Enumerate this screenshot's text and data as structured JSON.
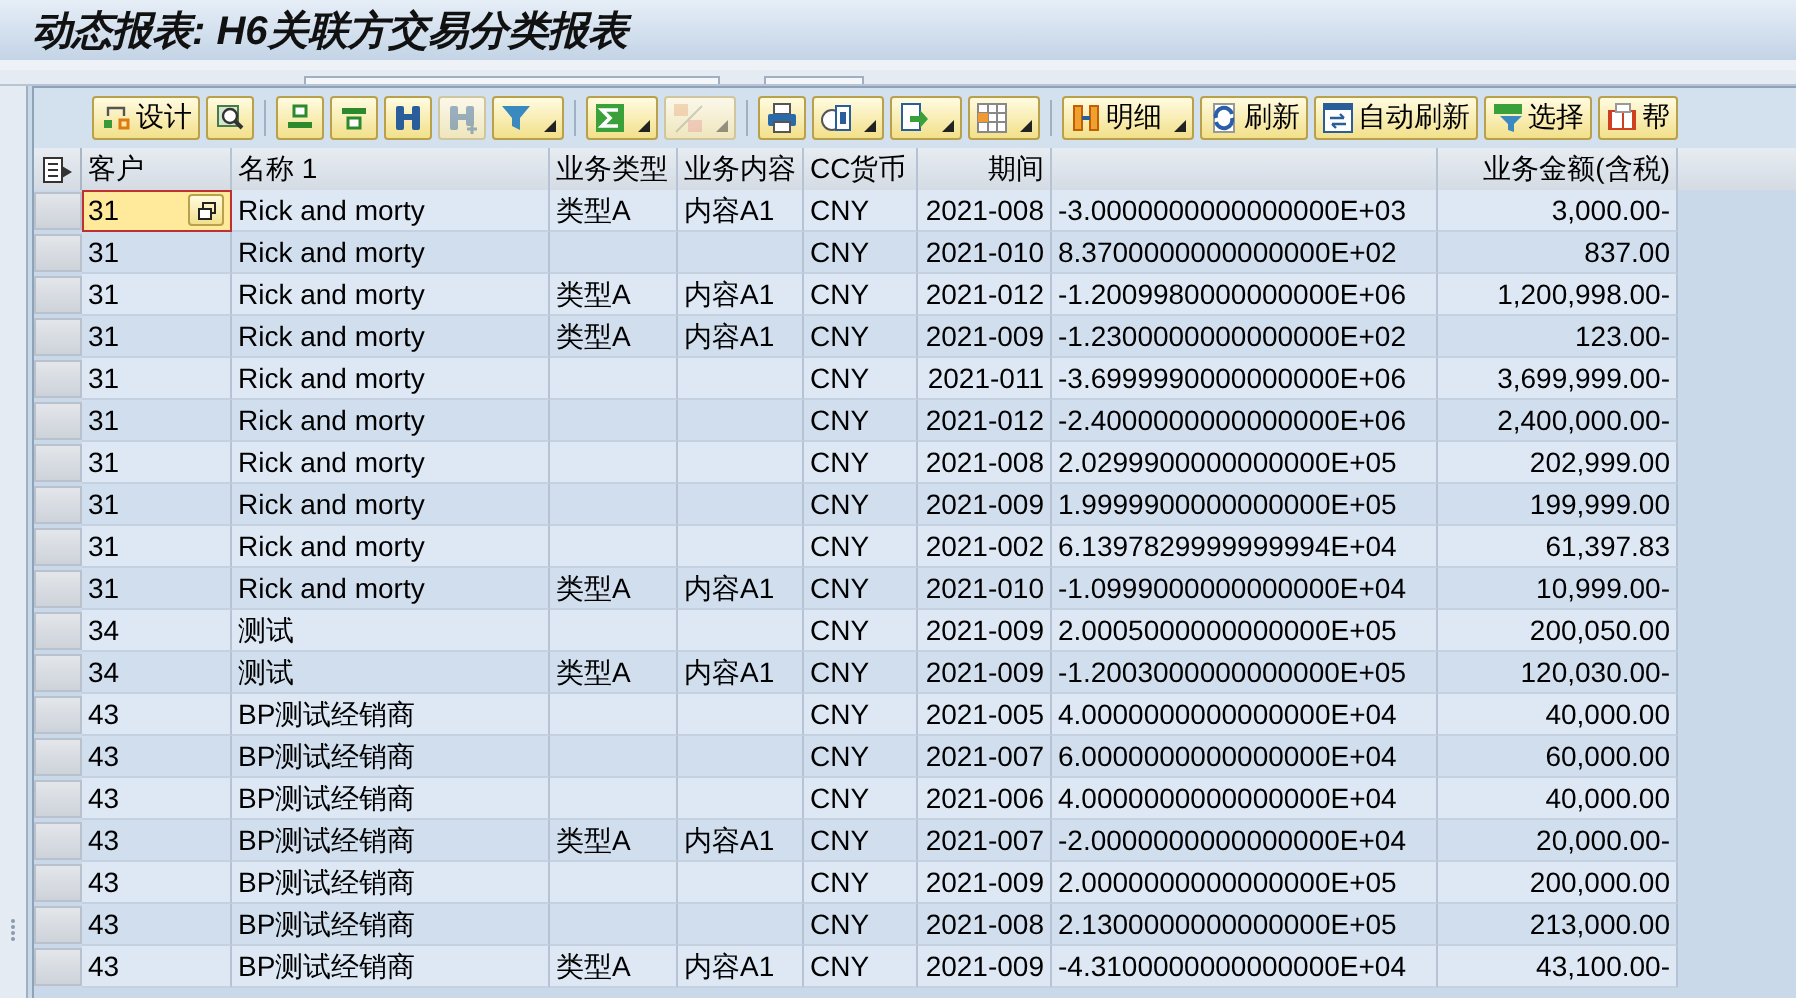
{
  "window": {
    "title": "动态报表: H6关联方交易分类报表"
  },
  "toolbar": [
    {
      "kind": "button",
      "label": "设计",
      "dropdown": false,
      "disabled": false
    },
    {
      "kind": "button",
      "dropdown": false,
      "disabled": false
    },
    {
      "kind": "separator"
    },
    {
      "kind": "button",
      "dropdown": false,
      "disabled": false
    },
    {
      "kind": "button",
      "dropdown": false,
      "disabled": false
    },
    {
      "kind": "button",
      "dropdown": false,
      "disabled": false
    },
    {
      "kind": "button",
      "dropdown": false,
      "disabled": true
    },
    {
      "kind": "button",
      "dropdown": true,
      "disabled": false
    },
    {
      "kind": "separator"
    },
    {
      "kind": "button",
      "dropdown": true,
      "disabled": false
    },
    {
      "kind": "button",
      "dropdown": true,
      "disabled": true
    },
    {
      "kind": "separator"
    },
    {
      "kind": "button",
      "dropdown": false,
      "disabled": false
    },
    {
      "kind": "button",
      "dropdown": true,
      "disabled": false
    },
    {
      "kind": "button",
      "dropdown": true,
      "disabled": false
    },
    {
      "kind": "button",
      "dropdown": true,
      "disabled": false
    },
    {
      "kind": "separator"
    },
    {
      "kind": "button",
      "label": "明细",
      "dropdown": true,
      "disabled": false
    },
    {
      "kind": "button",
      "label": "刷新",
      "dropdown": false,
      "disabled": false
    },
    {
      "kind": "button",
      "label": "自动刷新",
      "dropdown": false,
      "disabled": false
    },
    {
      "kind": "button",
      "label": "选择",
      "dropdown": false,
      "disabled": false
    },
    {
      "kind": "button",
      "label": "帮",
      "dropdown": false,
      "disabled": false
    }
  ],
  "table": {
    "columns": [
      {
        "label": "客户"
      },
      {
        "label": "名称 1"
      },
      {
        "label": "业务类型"
      },
      {
        "label": "业务内容"
      },
      {
        "label": "CC货币"
      },
      {
        "label": "期间"
      },
      {},
      {
        "label": "业务金额(含税)"
      }
    ],
    "rows": [
      {
        "focused": true,
        "customer": "31",
        "name": "Rick and morty",
        "type": "类型A",
        "content": "内容A1",
        "currency": "CNY",
        "period": "2021-008",
        "column_8": "-3.0000000000000000E+03",
        "amount": "3,000.00-"
      },
      {
        "focused": false,
        "customer": "31",
        "name": "Rick and morty",
        "currency": "CNY",
        "period": "2021-010",
        "column_8": "8.3700000000000000E+02",
        "amount": "837.00"
      },
      {
        "focused": false,
        "customer": "31",
        "name": "Rick and morty",
        "type": "类型A",
        "content": "内容A1",
        "currency": "CNY",
        "period": "2021-012",
        "column_8": "-1.2009980000000000E+06",
        "amount": "1,200,998.00-"
      },
      {
        "focused": false,
        "customer": "31",
        "name": "Rick and morty",
        "type": "类型A",
        "content": "内容A1",
        "currency": "CNY",
        "period": "2021-009",
        "column_8": "-1.2300000000000000E+02",
        "amount": "123.00-"
      },
      {
        "focused": false,
        "customer": "31",
        "name": "Rick and morty",
        "currency": "CNY",
        "period": "2021-011",
        "column_8": "-3.6999990000000000E+06",
        "amount": "3,699,999.00-"
      },
      {
        "focused": false,
        "customer": "31",
        "name": "Rick and morty",
        "currency": "CNY",
        "period": "2021-012",
        "column_8": "-2.4000000000000000E+06",
        "amount": "2,400,000.00-"
      },
      {
        "focused": false,
        "customer": "31",
        "name": "Rick and morty",
        "currency": "CNY",
        "period": "2021-008",
        "column_8": "2.0299900000000000E+05",
        "amount": "202,999.00"
      },
      {
        "focused": false,
        "customer": "31",
        "name": "Rick and morty",
        "currency": "CNY",
        "period": "2021-009",
        "column_8": "1.9999900000000000E+05",
        "amount": "199,999.00"
      },
      {
        "focused": false,
        "customer": "31",
        "name": "Rick and morty",
        "currency": "CNY",
        "period": "2021-002",
        "column_8": "6.1397829999999994E+04",
        "amount": "61,397.83"
      },
      {
        "focused": false,
        "customer": "31",
        "name": "Rick and morty",
        "type": "类型A",
        "content": "内容A1",
        "currency": "CNY",
        "period": "2021-010",
        "column_8": "-1.0999000000000000E+04",
        "amount": "10,999.00-"
      },
      {
        "focused": false,
        "customer": "34",
        "name": "测试",
        "currency": "CNY",
        "period": "2021-009",
        "column_8": "2.0005000000000000E+05",
        "amount": "200,050.00"
      },
      {
        "focused": false,
        "customer": "34",
        "name": "测试",
        "type": "类型A",
        "content": "内容A1",
        "currency": "CNY",
        "period": "2021-009",
        "column_8": "-1.2003000000000000E+05",
        "amount": "120,030.00-"
      },
      {
        "focused": false,
        "customer": "43",
        "name": "BP测试经销商",
        "currency": "CNY",
        "period": "2021-005",
        "column_8": "4.0000000000000000E+04",
        "amount": "40,000.00"
      },
      {
        "focused": false,
        "customer": "43",
        "name": "BP测试经销商",
        "currency": "CNY",
        "period": "2021-007",
        "column_8": "6.0000000000000000E+04",
        "amount": "60,000.00"
      },
      {
        "focused": false,
        "customer": "43",
        "name": "BP测试经销商",
        "currency": "CNY",
        "period": "2021-006",
        "column_8": "4.0000000000000000E+04",
        "amount": "40,000.00"
      },
      {
        "focused": false,
        "customer": "43",
        "name": "BP测试经销商",
        "type": "类型A",
        "content": "内容A1",
        "currency": "CNY",
        "period": "2021-007",
        "column_8": "-2.0000000000000000E+04",
        "amount": "20,000.00-"
      },
      {
        "focused": false,
        "customer": "43",
        "name": "BP测试经销商",
        "currency": "CNY",
        "period": "2021-009",
        "column_8": "2.0000000000000000E+05",
        "amount": "200,000.00"
      },
      {
        "focused": false,
        "customer": "43",
        "name": "BP测试经销商",
        "currency": "CNY",
        "period": "2021-008",
        "column_8": "2.1300000000000000E+05",
        "amount": "213,000.00"
      },
      {
        "focused": false,
        "customer": "43",
        "name": "BP测试经销商",
        "type": "类型A",
        "content": "内容A1",
        "currency": "CNY",
        "period": "2021-009",
        "column_8": "-4.3100000000000000E+04",
        "amount": "43,100.00-"
      }
    ]
  }
}
